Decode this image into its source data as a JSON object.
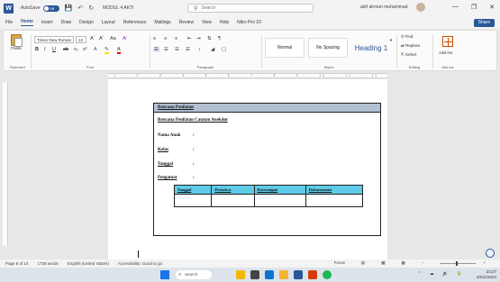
{
  "titlebar": {
    "autosave": "AutoSave",
    "autosave_state": "Off",
    "doc_title": "MODUL 4 AKTI",
    "search_placeholder": "Search",
    "user_name": "abif alrman muhammad"
  },
  "menu": {
    "tabs": [
      "File",
      "Home",
      "Insert",
      "Draw",
      "Design",
      "Layout",
      "References",
      "Mailings",
      "Review",
      "View",
      "Help",
      "Nitro Pro 10"
    ],
    "active": "Home",
    "share": "Share"
  },
  "ribbon": {
    "clipboard": {
      "label": "Clipboard",
      "paste": "Paste"
    },
    "font": {
      "label": "Font",
      "name": "Times New Roman",
      "size": "12"
    },
    "paragraph": {
      "label": "Paragraph"
    },
    "styles": {
      "label": "Styles",
      "items": [
        "Normal",
        "No Spacing",
        "Heading 1"
      ]
    },
    "editing": {
      "label": "Editing",
      "find": "Find",
      "replace": "Replace",
      "select": "Select"
    },
    "addins": {
      "label": "Add-ins",
      "button": "Add-ins"
    }
  },
  "document": {
    "header": "Rencana Penilaian",
    "subtitle": "Rencana Penilaian Catatan Anekdot",
    "fields": [
      "Nama Anak",
      "Kelas",
      "Tanggal",
      "Pengamat"
    ],
    "table_headers": [
      "Tanggal",
      "Peristiwa",
      "Keterangan",
      "Dokumentasi"
    ]
  },
  "statusbar": {
    "page": "Page 8 of 14",
    "words": "1738 words",
    "language": "English (United States)",
    "accessibility": "Accessibility: Good to go",
    "focus": "Focus"
  },
  "taskbar": {
    "search": "Search",
    "time": "23:27",
    "date": "10/11/2024"
  }
}
